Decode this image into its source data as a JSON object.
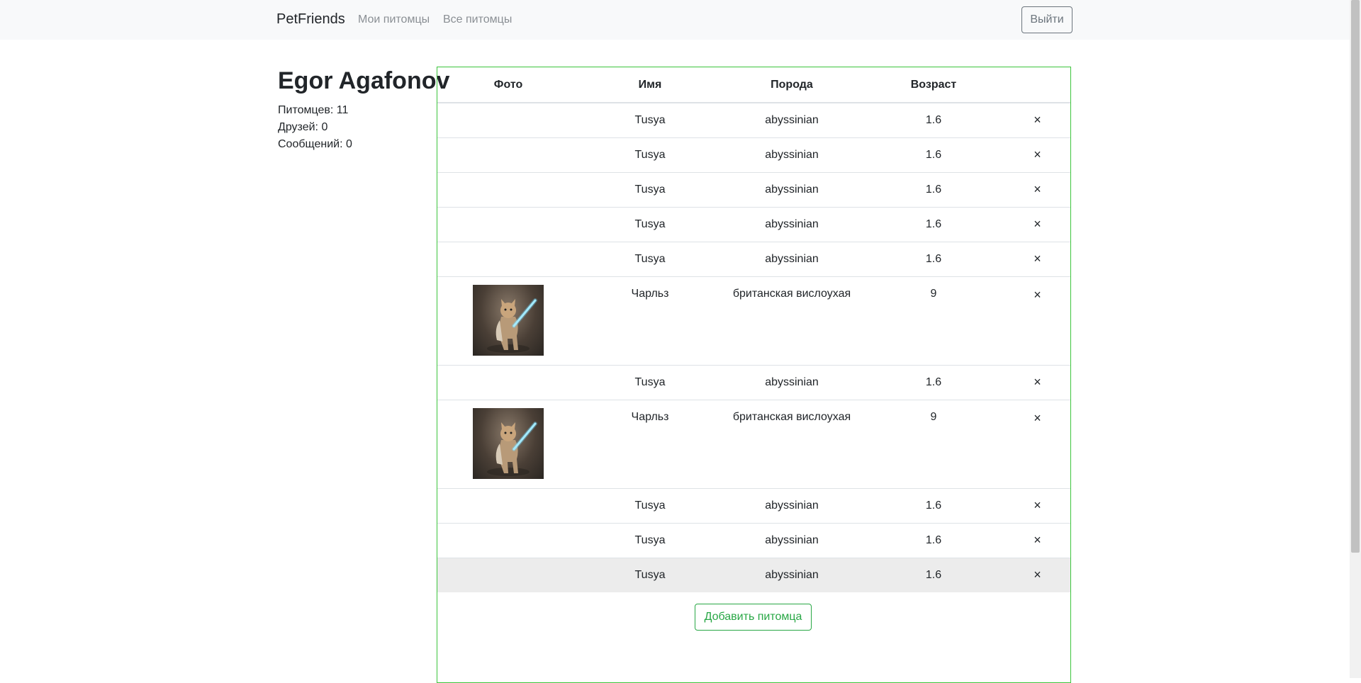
{
  "navbar": {
    "brand": "PetFriends",
    "links": [
      "Мои питомцы",
      "Все питомцы"
    ],
    "logout_label": "Выйти"
  },
  "profile": {
    "name": "Egor Agafonov",
    "pets": "Питомцев: 11",
    "friends": "Друзей: 0",
    "messages": "Сообщений: 0"
  },
  "table": {
    "headers": [
      "Фото",
      "Имя",
      "Порода",
      "Возраст",
      ""
    ],
    "delete_symbol": "×",
    "rows": [
      {
        "name": "Tusya",
        "breed": "abyssinian",
        "age": "1.6",
        "photo": false
      },
      {
        "name": "Tusya",
        "breed": "abyssinian",
        "age": "1.6",
        "photo": false
      },
      {
        "name": "Tusya",
        "breed": "abyssinian",
        "age": "1.6",
        "photo": false
      },
      {
        "name": "Tusya",
        "breed": "abyssinian",
        "age": "1.6",
        "photo": false
      },
      {
        "name": "Tusya",
        "breed": "abyssinian",
        "age": "1.6",
        "photo": false
      },
      {
        "name": "Чарльз",
        "breed": "британская вислоухая",
        "age": "9",
        "photo": true
      },
      {
        "name": "Tusya",
        "breed": "abyssinian",
        "age": "1.6",
        "photo": false
      },
      {
        "name": "Чарльз",
        "breed": "британская вислоухая",
        "age": "9",
        "photo": true
      },
      {
        "name": "Tusya",
        "breed": "abyssinian",
        "age": "1.6",
        "photo": false
      },
      {
        "name": "Tusya",
        "breed": "abyssinian",
        "age": "1.6",
        "photo": false
      },
      {
        "name": "Tusya",
        "breed": "abyssinian",
        "age": "1.6",
        "photo": false,
        "highlighted": true
      }
    ]
  },
  "add_button_label": "Добавить питомца",
  "colors": {
    "navbar_bg": "#f8f9fa",
    "table_border": "#3cc43c",
    "add_button": "#28a745",
    "highlight_row": "#ececec"
  }
}
